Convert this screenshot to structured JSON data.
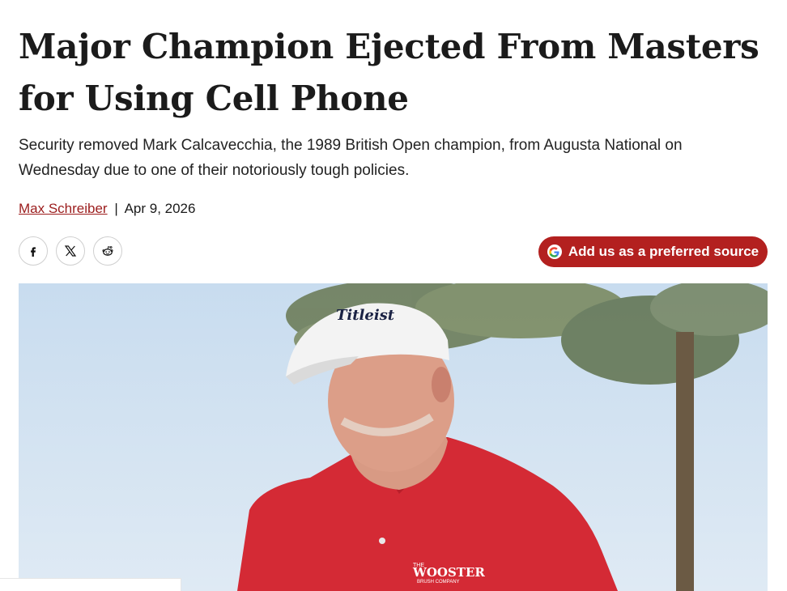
{
  "article": {
    "headline": "Major Champion Ejected From Masters for Using Cell Phone",
    "dek": "Security removed Mark Calcavecchia, the 1989 British Open champion, from Augusta National on Wednesday due to one of their notoriously tough policies.",
    "author": "Max Schreiber",
    "separator": "|",
    "date": "Apr 9, 2026"
  },
  "share": {
    "icons": [
      "facebook-icon",
      "x-icon",
      "reddit-icon"
    ]
  },
  "preferred_source": {
    "label": "Add us as a preferred source",
    "icon": "google-icon",
    "color": "#b3201f"
  },
  "hero_image": {
    "cap_text": "Titleist",
    "shirt_logo_main": "WOOSTER",
    "shirt_logo_top": "THE",
    "shirt_logo_bottom": "BRUSH COMPANY"
  }
}
